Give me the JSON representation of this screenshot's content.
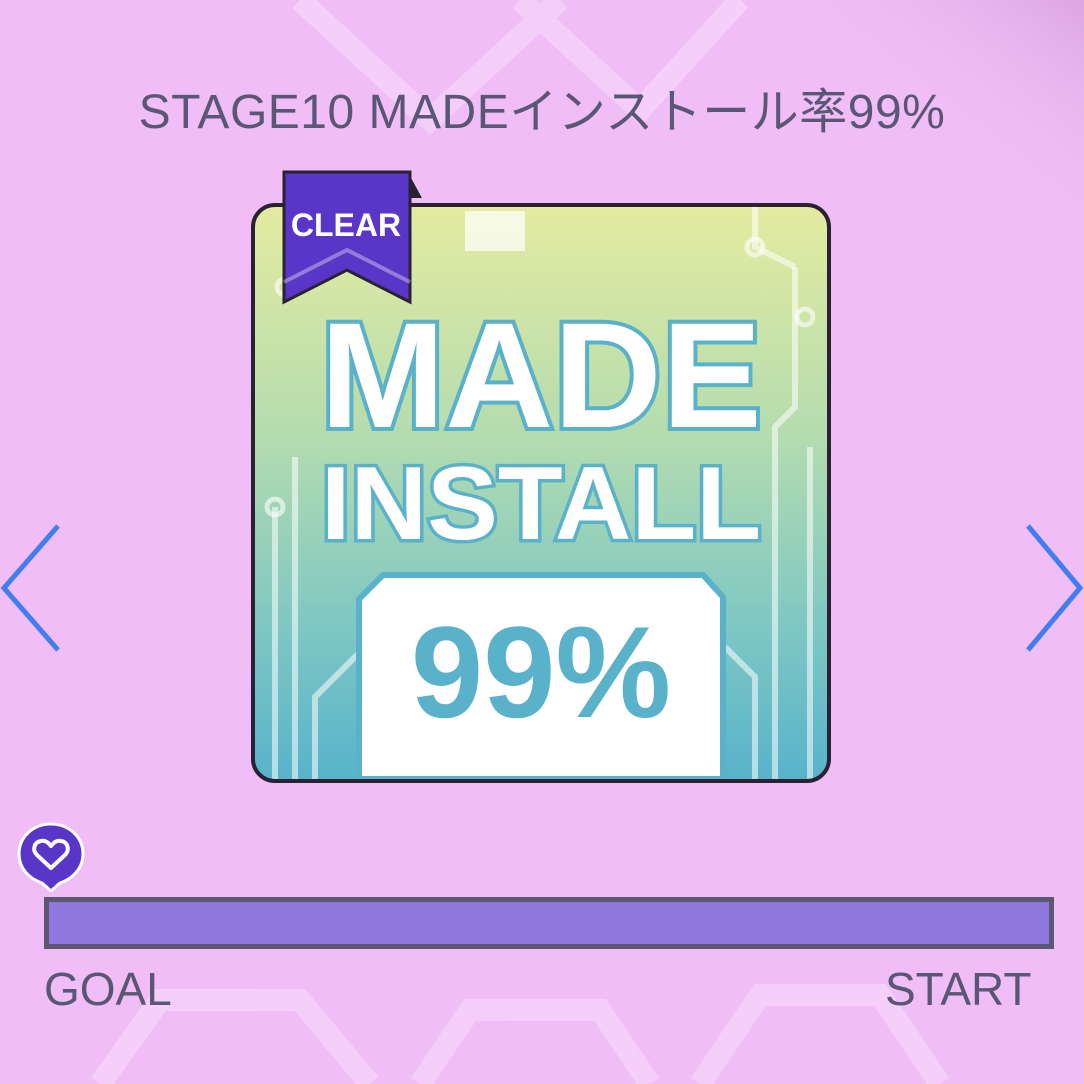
{
  "stage": {
    "title": "STAGE10 MADEインストール率99%"
  },
  "card": {
    "clear_badge": "CLEAR",
    "artwork": {
      "line1": "MADE",
      "line2": "INSTALL",
      "percent": "99%"
    }
  },
  "progress": {
    "goal_label": "GOAL",
    "start_label": "START",
    "fill_fraction": 1.0,
    "marker_icon": "heart-pin-icon"
  },
  "navigation": {
    "prev_icon": "chevron-left-icon",
    "next_icon": "chevron-right-icon"
  },
  "colors": {
    "background": "#f0bdf6",
    "title_text": "#5a5776",
    "arrow": "#3f7df0",
    "badge": "#5a36c8",
    "progress_fill": "#8e78df",
    "progress_border": "#5c5870",
    "artwork_text": "#5ab2ca"
  }
}
